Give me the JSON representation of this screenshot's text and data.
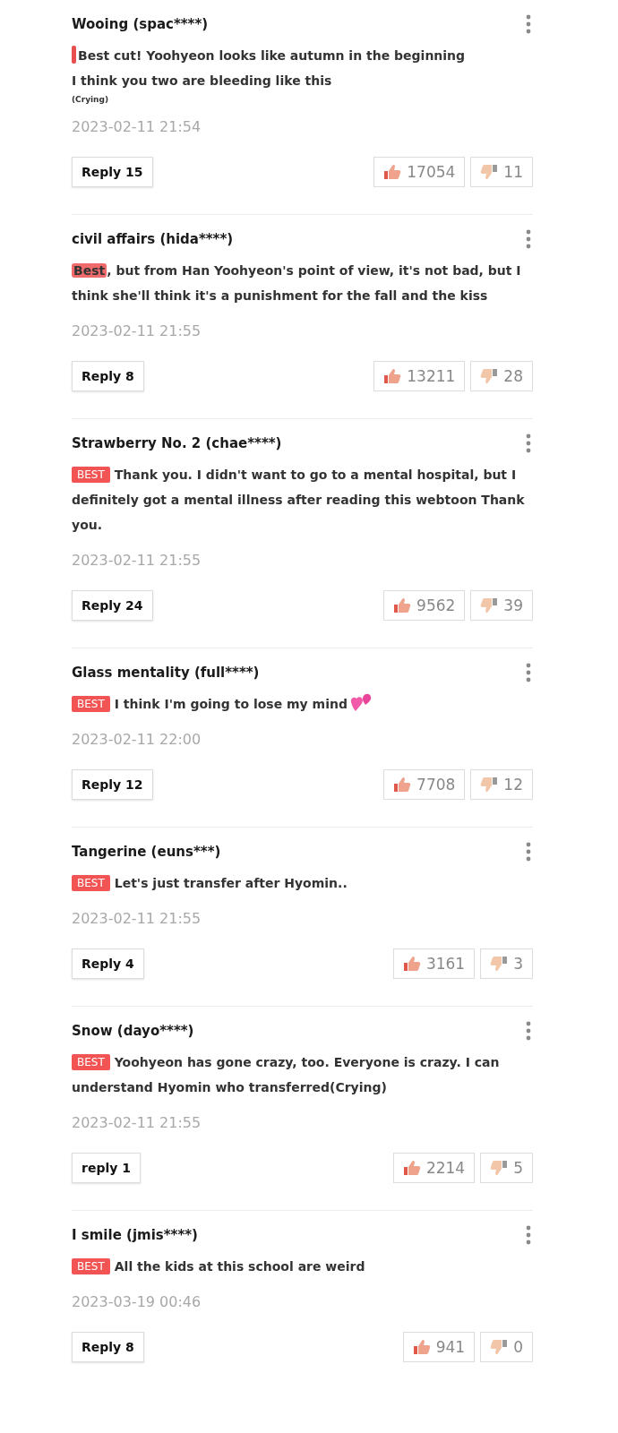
{
  "comments": [
    {
      "author": "Wooing (spac****)",
      "kind": "bar",
      "body": "Best cut! Yoohyeon looks like autumn in the beginning\nI think you two are bleeding like this",
      "note": "(Crying)",
      "heart_emoji": false,
      "date": "2023-02-11 21:54",
      "reply": "Reply 15",
      "likes": "17054",
      "dislikes": "11"
    },
    {
      "author": "civil affairs (hida****)",
      "kind": "highlight",
      "highlight": "Best",
      "body": ", but from Han Yoohyeon's point of view, it's not bad, but I think she'll think it's a punishment for the fall and the kiss",
      "heart_emoji": false,
      "date": "2023-02-11 21:55",
      "reply": "Reply 8",
      "likes": "13211",
      "dislikes": "28"
    },
    {
      "author": "Strawberry No. 2 (chae****)",
      "kind": "badge",
      "badge": "BEST",
      "body": "Thank you. I didn't want to go to a mental hospital, but I definitely got a mental illness after reading this webtoon Thank you.",
      "heart_emoji": false,
      "date": "2023-02-11 21:55",
      "reply": "Reply 24",
      "likes": "9562",
      "dislikes": "39"
    },
    {
      "author": "Glass mentality (full****)",
      "kind": "badge",
      "badge": "BEST",
      "body": "I think I'm going to lose my mind",
      "heart_emoji": true,
      "date": "2023-02-11 22:00",
      "reply": "Reply 12",
      "likes": "7708",
      "dislikes": "12"
    },
    {
      "author": "Tangerine (euns***)",
      "kind": "badge",
      "badge": "BEST",
      "body": "Let's just transfer after Hyomin..",
      "heart_emoji": false,
      "date": "2023-02-11 21:55",
      "reply": "Reply 4",
      "likes": "3161",
      "dislikes": "3"
    },
    {
      "author": "Snow (dayo****)",
      "kind": "badge",
      "badge": "BEST",
      "body": "Yoohyeon has gone crazy, too. Everyone is crazy. I can understand Hyomin who transferred(Crying)",
      "heart_emoji": false,
      "date": "2023-02-11 21:55",
      "reply": "reply 1",
      "likes": "2214",
      "dislikes": "5"
    },
    {
      "author": "I smile (jmis****)",
      "kind": "badge",
      "badge": "BEST",
      "body": "All the kids at this school are weird",
      "heart_emoji": false,
      "date": "2023-03-19 00:46",
      "reply": "Reply 8",
      "likes": "941",
      "dislikes": "0"
    }
  ]
}
